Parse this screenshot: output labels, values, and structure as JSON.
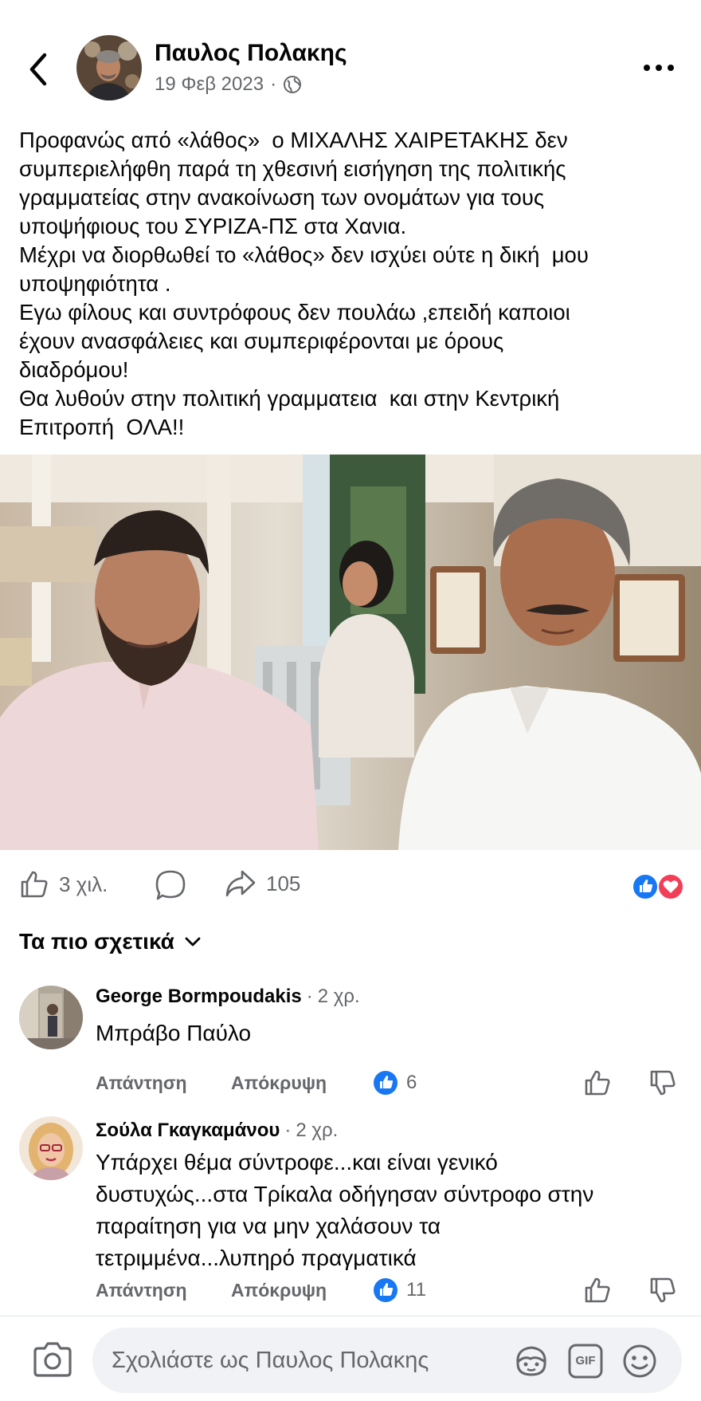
{
  "post": {
    "author": "Παυλος Πολακης",
    "date": "19 Φεβ 2023",
    "separator": "·",
    "text": [
      "Προφανώς από «λάθος»  ο ΜΙΧΑΛΗΣ ΧΑΙΡΕΤΑΚΗΣ δεν",
      "συμπεριελήφθη παρά τη χθεσινή εισήγηση της πολιτικής",
      "γραμματείας στην ανακοίνωση των ονομάτων για τους",
      "υποψήφιους του ΣΥΡΙΖΑ-ΠΣ στα Χανια.",
      "Μέχρι να διορθωθεί το «λάθος» δεν ισχύει ούτε η δική  μου",
      "υποψηφιότητα .",
      "Εγω φίλους και συντρόφους δεν πουλάω ,επειδή καποιοι",
      "έχουν ανασφάλειες και συμπεριφέρονται με όρους",
      "διαδρόμου!",
      "Θα λυθούν στην πολιτική γραμματεια  και στην Κεντρική",
      "Επιτροπή  ΟΛΑ!!"
    ]
  },
  "actions": {
    "likes": "3 χιλ.",
    "shares": "105"
  },
  "sort_label": "Τα πιο σχετικά",
  "comments": [
    {
      "author": "George Bormpoudakis",
      "time": "2 χρ.",
      "text": "Μπράβο Παύλο",
      "reply": "Απάντηση",
      "hide": "Απόκρυψη",
      "likes": "6"
    },
    {
      "author": "Σούλα Γκαγκαμάνου",
      "time": "2 χρ.",
      "text_lines": [
        "Υπάρχει θέμα σύντροφε...και είναι γενικό",
        "δυστυχώς...στα Τρίκαλα οδήγησαν σύντροφο στην",
        "παραίτηση για να μην χαλάσουν τα",
        "τετριμμένα...λυπηρό πραγματικά"
      ],
      "reply": "Απάντηση",
      "hide": "Απόκρυψη",
      "likes": "11"
    }
  ],
  "footer": {
    "placeholder": "Σχολιάστε ως Παυλος Πολακης",
    "gif_label": "GIF"
  },
  "colors": {
    "like_blue": "#1877f2",
    "love_red": "#f33e58",
    "secondary_text": "#65676b"
  },
  "icons": [
    "back-arrow-icon",
    "globe-icon",
    "more-dots-icon",
    "like-icon",
    "comment-icon",
    "share-icon",
    "chevron-down-icon",
    "thumbs-up-icon",
    "thumbs-down-icon",
    "camera-icon",
    "avatar-sticker-icon",
    "gif-icon",
    "emoji-icon"
  ]
}
